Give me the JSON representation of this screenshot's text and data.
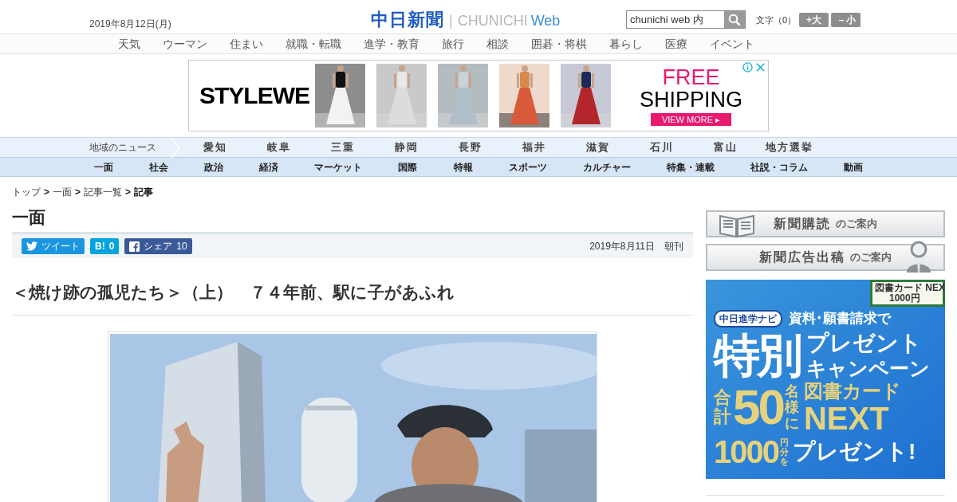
{
  "header": {
    "date": "2019年8月12日(月)",
    "logo": {
      "kanji": "中日新聞",
      "divider": "|",
      "latin_1": "CHUNICHI",
      "latin_2": "Web"
    },
    "search": {
      "value": "chunichi web 内"
    },
    "font_size": {
      "label": "文字（0）",
      "buttons": [
        "+大",
        "－小"
      ]
    }
  },
  "top_nav": [
    "天気",
    "ウーマン",
    "住まい",
    "就職・転職",
    "進学・教育",
    "旅行",
    "相談",
    "囲碁・将棋",
    "暮らし",
    "医療",
    "イベント"
  ],
  "ad": {
    "brand": "STYLEWE",
    "headline_1": "FREE",
    "headline_2": "SHIPPING",
    "cta": "VIEW MORE ▸"
  },
  "regional_nav": {
    "label": "地域のニュース",
    "items": [
      "愛知",
      "岐阜",
      "三重",
      "静岡",
      "長野",
      "福井",
      "滋賀",
      "石川",
      "富山",
      "地方選挙"
    ]
  },
  "section_nav": [
    "一面",
    "社会",
    "政治",
    "経済",
    "マーケット",
    "国際",
    "特報",
    "スポーツ",
    "カルチャー",
    "特集・連載",
    "社説・コラム",
    "動画"
  ],
  "breadcrumb": {
    "separator": ">",
    "items": [
      {
        "label": "トップ",
        "current": false
      },
      {
        "label": "一面",
        "current": false
      },
      {
        "label": "記事一覧",
        "current": false
      },
      {
        "label": "記事",
        "current": true
      }
    ]
  },
  "section_title": "一面",
  "share": [
    {
      "kind": "twitter",
      "label": "ツイート"
    },
    {
      "kind": "hatena",
      "label": "B!",
      "count": "0"
    },
    {
      "kind": "facebook",
      "label": "シェア",
      "count": "10"
    }
  ],
  "article": {
    "date": "2019年8月11日",
    "edition": "朝刊",
    "headline": "＜焼け跡の孤児たち＞（上）　７４年前、駅に子があふれ"
  },
  "sidebar": {
    "buttons": [
      {
        "kind": "subscribe",
        "main": "新聞購読",
        "sub": "のご案内"
      },
      {
        "kind": "advertise",
        "main": "新聞広告出稿",
        "sub": "のご案内"
      }
    ],
    "banner": {
      "site": "中日進学ナビ",
      "lead": "資料･願書請求で",
      "big": "特別",
      "line_1": "プレゼント",
      "line_2": "キャンペーン",
      "total": "合計",
      "count": "50",
      "suffix": "名様に",
      "prize_1": "図書カード",
      "prize_2": "NEXT",
      "amount": "1000",
      "amount_unit": "円分を",
      "closing": "プレゼント!",
      "card_1": "図書カード NEX",
      "card_2": "1000円"
    }
  }
}
